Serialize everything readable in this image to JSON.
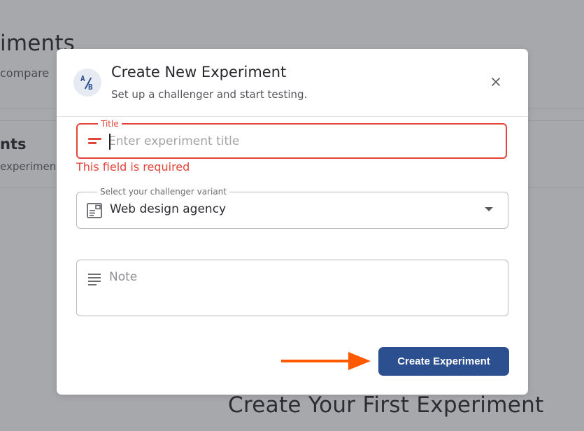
{
  "background": {
    "page_title": "iments",
    "page_subtitle": "compare",
    "section_title": "nts",
    "section_subtitle": "experimen",
    "cta_text": "Create Your First Experiment"
  },
  "modal": {
    "icon_letters": {
      "a": "A",
      "b": "B"
    },
    "title": "Create New Experiment",
    "subtitle": "Set up a challenger and start testing.",
    "close_icon": "close-icon",
    "fields": {
      "title": {
        "label": "Title",
        "placeholder": "Enter experiment title",
        "value": "",
        "error": "This field is required",
        "icon": "title-icon"
      },
      "variant": {
        "label": "Select your challenger variant",
        "value": "Web design agency",
        "icon": "page-layout-icon"
      },
      "note": {
        "placeholder": "Note",
        "value": "",
        "icon": "notes-icon"
      }
    },
    "submit_label": "Create Experiment"
  },
  "colors": {
    "accent": "#2c4f8f",
    "error": "#e2453a",
    "arrow": "#ff5a00",
    "overlay": "#a7a8ab"
  }
}
